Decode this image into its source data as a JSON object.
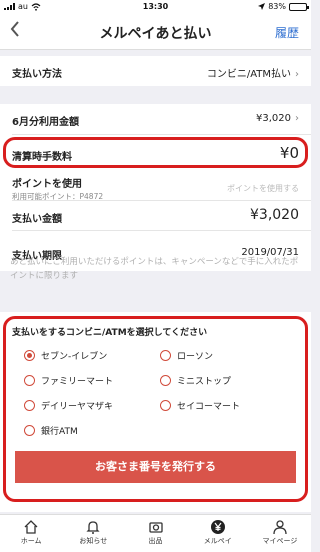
{
  "status_bar": {
    "carrier": "au",
    "time": "13:30",
    "battery": "83%",
    "battery_level": 0.83
  },
  "nav": {
    "back_icon": "chevron-left-icon",
    "title": "メルペイあと払い",
    "history_label": "履歴"
  },
  "payment_method": {
    "label": "支払い方法",
    "value": "コンビニ/ATM払い"
  },
  "usage": {
    "amount_label": "6月分利用金額",
    "amount_value": "¥3,020",
    "fee_label": "清算時手数料",
    "fee_value": "¥0",
    "points_label": "ポイントを使用",
    "points_sub": "利用可能ポイント：P4872",
    "points_placeholder": "ポイントを使用する",
    "total_label": "支払い金額",
    "total_value": "¥3,020",
    "deadline_label": "支払い期限",
    "deadline_value": "2019/07/31"
  },
  "note": "あと払いにご利用いただけるポイントは、キャンペーンなどで手に入れたポイントに限ります",
  "store_select": {
    "heading": "支払いをするコンビニ/ATMを選択してください",
    "options": [
      "セブン-イレブン",
      "ローソン",
      "ファミリーマート",
      "ミニストップ",
      "デイリーヤマザキ",
      "セイコーマート",
      "銀行ATM"
    ],
    "selected_index": 0,
    "button_label": "お客さま番号を発行する"
  },
  "tabbar": [
    {
      "label": "ホーム",
      "icon": "home-icon"
    },
    {
      "label": "お知らせ",
      "icon": "bell-icon"
    },
    {
      "label": "出品",
      "icon": "camera-icon"
    },
    {
      "label": "メルペイ",
      "icon": "yen-icon"
    },
    {
      "label": "マイページ",
      "icon": "person-icon"
    }
  ],
  "colors": {
    "accent": "#d9544a",
    "highlight": "#d81e1e",
    "link": "#2f6fd1"
  }
}
